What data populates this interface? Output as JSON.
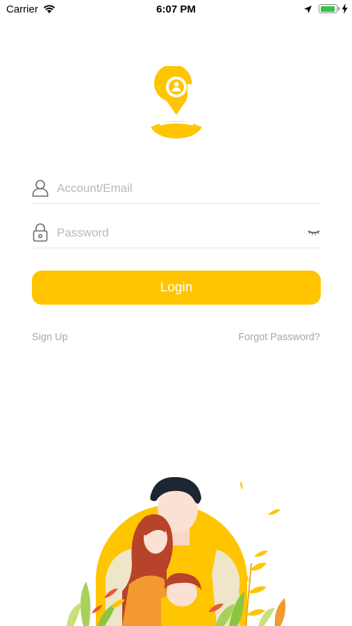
{
  "status_bar": {
    "carrier": "Carrier",
    "time": "6:07 PM",
    "battery_level": 0.92,
    "icons": [
      "wifi-icon",
      "location-arrow-icon",
      "battery-icon",
      "charging-bolt-icon"
    ]
  },
  "logo": {
    "icon": "location-pin-user-icon"
  },
  "login_form": {
    "account": {
      "value": "",
      "placeholder": "Account/Email",
      "icon": "user-icon"
    },
    "password": {
      "value": "",
      "placeholder": "Password",
      "icon": "lock-icon",
      "toggle_icon": "eye-closed-icon"
    },
    "login_label": "Login"
  },
  "links": {
    "sign_up": "Sign Up",
    "forgot_password": "Forgot Password?"
  },
  "colors": {
    "accent": "#FEC500",
    "accent_light": "#FFD966",
    "text_muted": "#A8A8A8",
    "placeholder": "#B8B8B8"
  },
  "illustration": {
    "icon": "family-illustration"
  }
}
